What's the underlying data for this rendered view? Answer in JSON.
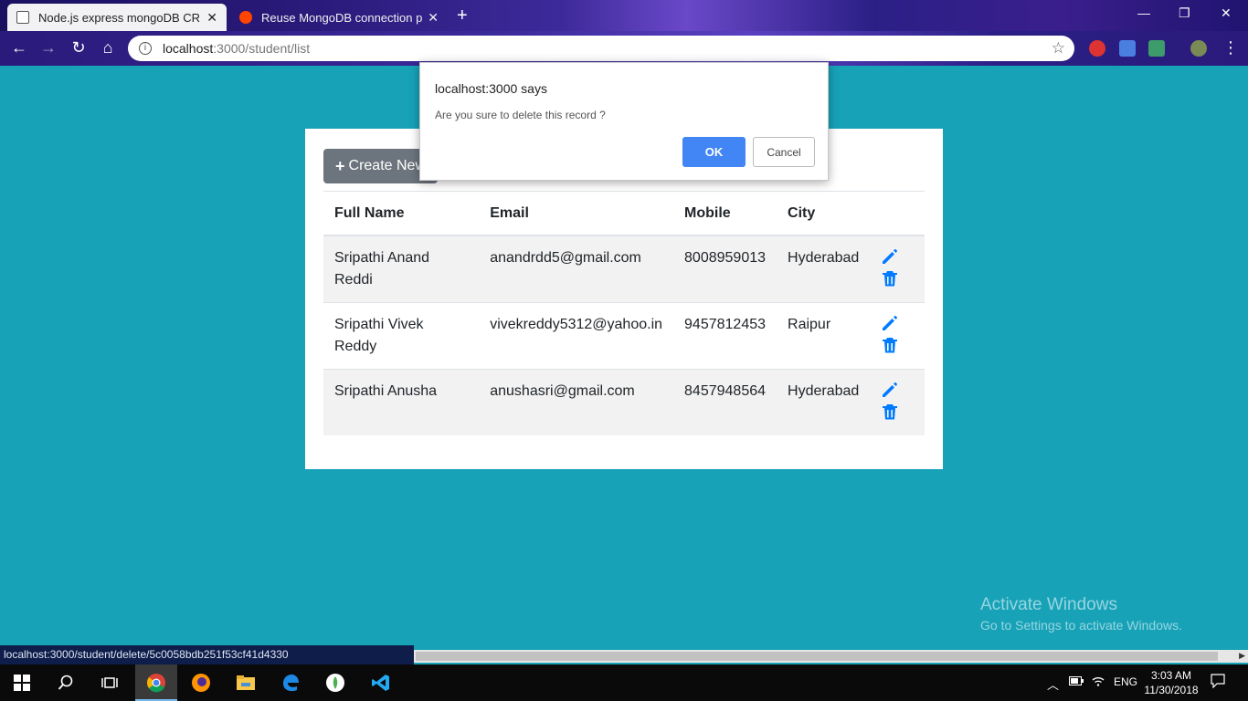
{
  "browser": {
    "tabs": [
      {
        "title": "Node.js express mongoDB CRUD",
        "close": "✕"
      },
      {
        "title": "Reuse MongoDB connection pro",
        "close": "✕"
      }
    ],
    "new_tab": "+",
    "url_host": "localhost",
    "url_path": ":3000/student/list",
    "window_buttons": [
      "—",
      "❐",
      "✕"
    ]
  },
  "page": {
    "create_button": "Create New",
    "table": {
      "headers": [
        "Full Name",
        "Email",
        "Mobile",
        "City"
      ],
      "rows": [
        {
          "name": "Sripathi Anand Reddi",
          "email": "anandrdd5@gmail.com",
          "mobile": "8008959013",
          "city": "Hyderabad"
        },
        {
          "name": "Sripathi Vivek Reddy",
          "email": "vivekreddy5312@yahoo.in",
          "mobile": "9457812453",
          "city": "Raipur"
        },
        {
          "name": "Sripathi Anusha",
          "email": "anushasri@gmail.com",
          "mobile": "8457948564",
          "city": "Hyderabad"
        }
      ]
    }
  },
  "dialog": {
    "title": "localhost:3000 says",
    "message": "Are you sure to delete this record ?",
    "ok": "OK",
    "cancel": "Cancel"
  },
  "status_url": "localhost:3000/student/delete/5c0058bdb251f53cf41d4330",
  "watermark": {
    "line1": "Activate Windows",
    "line2": "Go to Settings to activate Windows."
  },
  "taskbar": {
    "lang": "ENG",
    "time": "3:03 AM",
    "date": "11/30/2018"
  },
  "colors": {
    "page_bg": "#17a2b8",
    "primary": "#007bff",
    "secondary_btn": "#6c757d",
    "ok_btn": "#4285f4"
  }
}
